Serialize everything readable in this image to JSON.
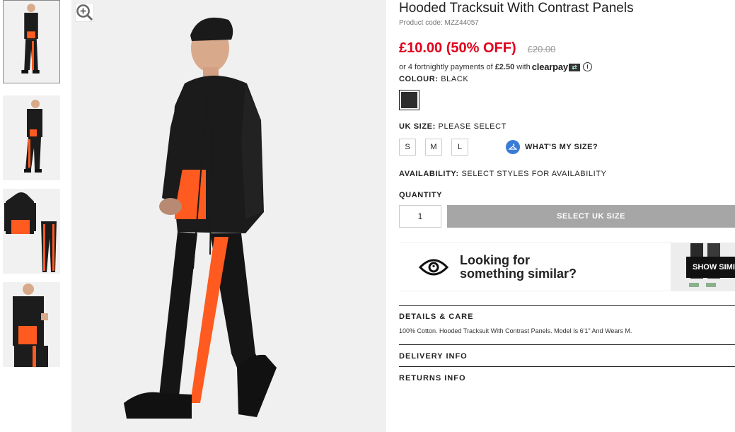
{
  "product": {
    "title": "Hooded Tracksuit With Contrast Panels",
    "code": "Product code: MZZ44057",
    "price_now": "£10.00 (50% OFF)",
    "price_was": "£20.00"
  },
  "clearpay": {
    "prefix": "or 4 fortnightly payments of",
    "amount": "£2.50",
    "with": "with",
    "logo": "clearpay",
    "info_icon": "i"
  },
  "colour": {
    "label": "COLOUR:",
    "value": "BLACK",
    "swatch_color": "#2d2d2d"
  },
  "size": {
    "label": "UK SIZE:",
    "value": "PLEASE SELECT",
    "options": [
      "S",
      "M",
      "L"
    ],
    "guide_label": "WHAT'S MY SIZE?"
  },
  "availability": {
    "label": "AVAILABILITY:",
    "value": "SELECT STYLES FOR AVAILABILITY"
  },
  "quantity": {
    "label": "QUANTITY",
    "value": "1"
  },
  "add_button": "SELECT UK SIZE",
  "similar": {
    "line1": "Looking for",
    "line2": "something similar?",
    "button": "SHOW SIMI"
  },
  "sections": {
    "details_title": "DETAILS & CARE",
    "details_body": "100% Cotton. Hooded Tracksuit With Contrast Panels. Model Is 6'1\" And Wears M.",
    "delivery_title": "DELIVERY INFO",
    "returns_title": "RETURNS INFO"
  },
  "colors": {
    "sale_red": "#e0001b",
    "accent_orange": "#ff5a1f",
    "button_grey": "#a6a6a6"
  }
}
